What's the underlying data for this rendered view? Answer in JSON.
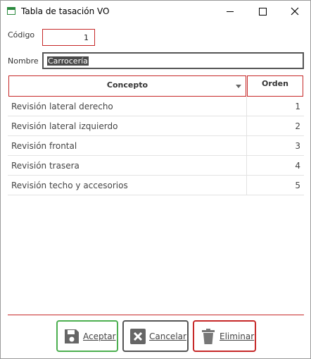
{
  "window": {
    "title": "Tabla de tasación VO"
  },
  "form": {
    "code_label": "Código",
    "code_value": "1",
    "name_label": "Nombre",
    "name_value": "Carrocería"
  },
  "grid": {
    "columns": [
      "Concepto",
      "Orden"
    ],
    "rows": [
      {
        "concept": "Revisión lateral derecho",
        "order": "1"
      },
      {
        "concept": "Revisión lateral izquierdo",
        "order": "2"
      },
      {
        "concept": "Revisión frontal",
        "order": "3"
      },
      {
        "concept": "Revisión trasera",
        "order": "4"
      },
      {
        "concept": "Revisión techo y accesorios",
        "order": "5"
      }
    ]
  },
  "buttons": {
    "accept": "Aceptar",
    "cancel": "Cancelar",
    "delete": "Eliminar"
  },
  "colors": {
    "accent_red": "#c62828",
    "accept_green": "#4caf50",
    "icon_gray": "#666666"
  },
  "icons": [
    "app-icon",
    "minimize-icon",
    "maximize-icon",
    "close-icon",
    "sort-arrow-icon",
    "save-icon",
    "cancel-icon",
    "trash-icon"
  ]
}
